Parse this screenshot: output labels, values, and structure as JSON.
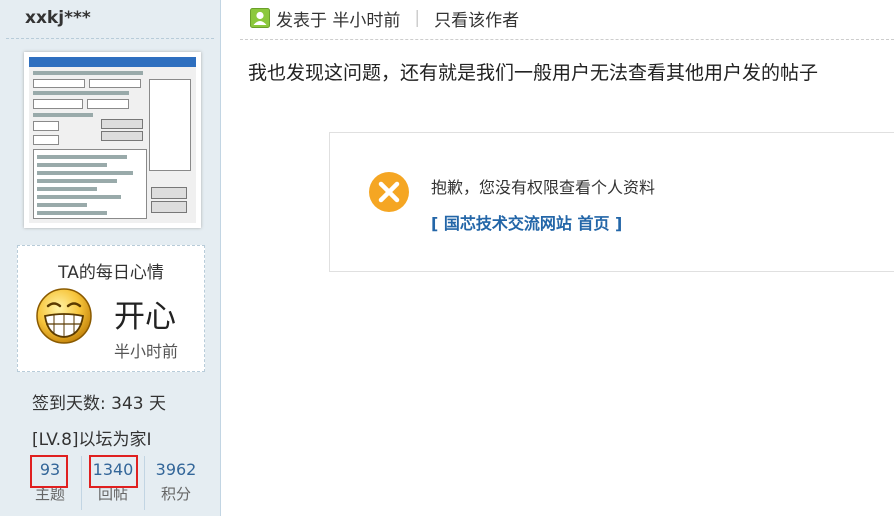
{
  "sidebar": {
    "username": "xxkj***",
    "mood": {
      "title": "TA的每日心情",
      "name": "开心",
      "time": "半小时前"
    },
    "signin": "签到天数: 343 天",
    "level": "[LV.8]以坛为家I",
    "stats": [
      {
        "value": "93",
        "label": "主题",
        "highlighted": true
      },
      {
        "value": "1340",
        "label": "回帖",
        "highlighted": true
      },
      {
        "value": "3962",
        "label": "积分",
        "highlighted": false
      }
    ]
  },
  "post": {
    "posted_prefix": "发表于 半小时前",
    "separator": "|",
    "author_only": "只看该作者",
    "content": "我也发现这问题，还有就是我们一般用户无法查看其他用户发的帖子"
  },
  "error": {
    "message": "抱歉，您没有权限查看个人资料",
    "link": "[ 国芯技术交流网站 首页 ]"
  },
  "colors": {
    "sidebar_bg": "#e5edf2",
    "link": "#336699",
    "highlight": "#e02020",
    "error_icon": "#f5a623",
    "online_icon": "#8cc83c"
  }
}
